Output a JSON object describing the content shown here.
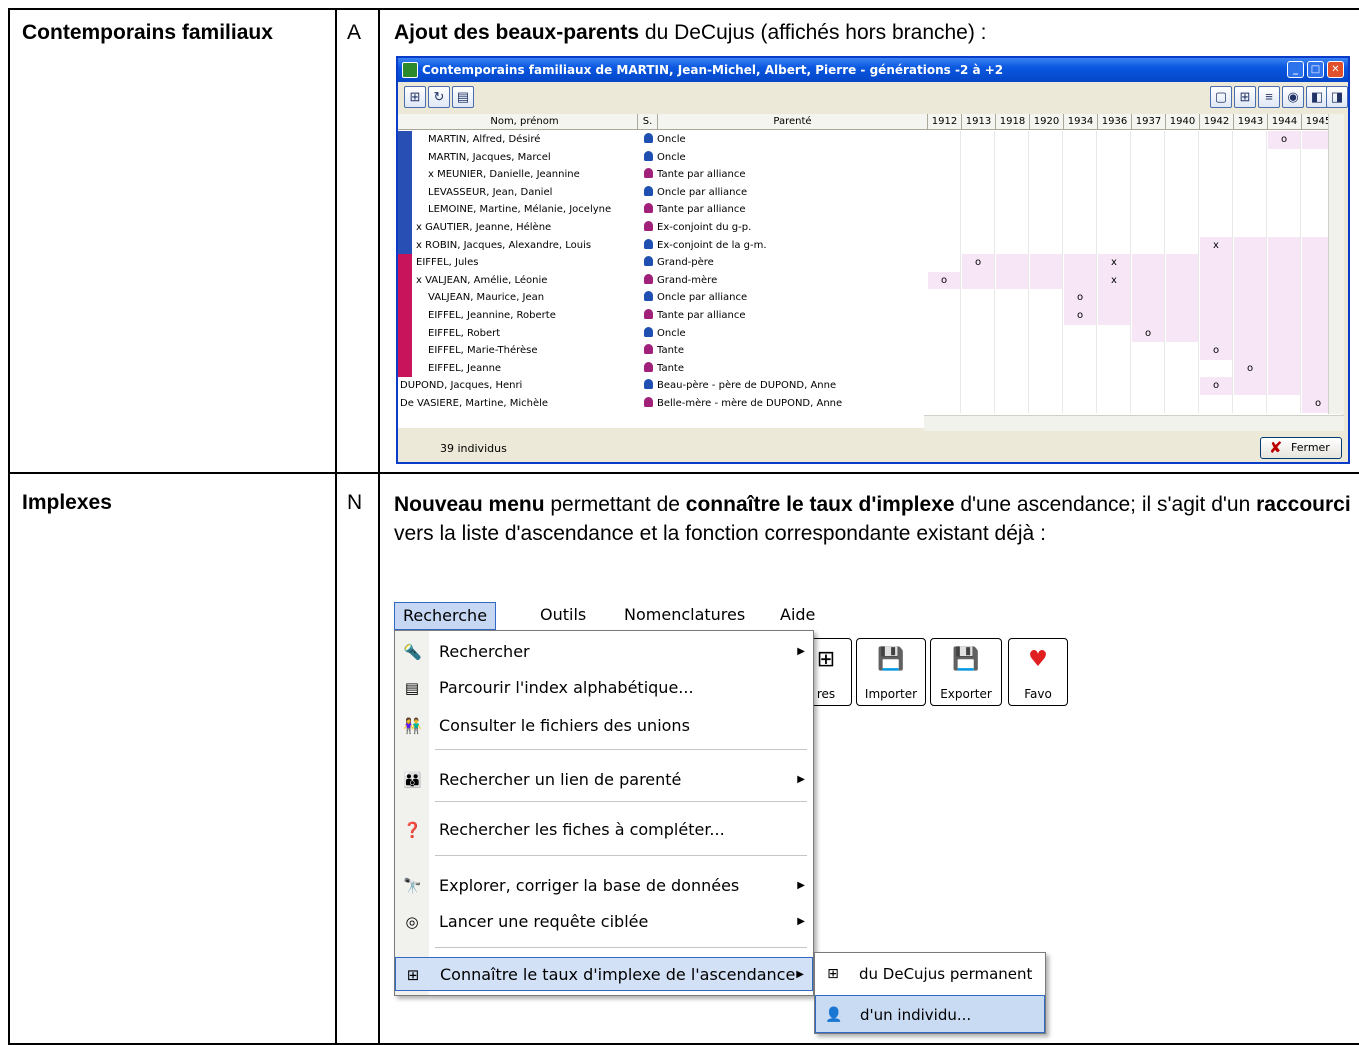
{
  "rows": [
    {
      "feature": "Contemporains familiaux",
      "code": "A",
      "desc_bold": "Ajout des beaux-parents",
      "desc_rest": " du DeCujus (affichés hors branche) :"
    },
    {
      "feature": "Implexes",
      "code": "N",
      "desc_parts": [
        {
          "t": "Nouveau menu",
          "b": true
        },
        {
          "t": " permettant de ",
          "b": false
        },
        {
          "t": "connaître le taux d'implexe",
          "b": true
        },
        {
          "t": " d'une ascendance; il s'agit d'un ",
          "b": false
        },
        {
          "t": "raccourci",
          "b": true
        },
        {
          "t": " vers la liste d'ascendance et la fonction correspondante existant déjà :",
          "b": false
        }
      ]
    }
  ],
  "window": {
    "title": "Contemporains familiaux de MARTIN, Jean-Michel, Albert, Pierre  -  générations -2 à +2",
    "columns": {
      "name": "Nom, prénom",
      "sex": "S.",
      "relation": "Parenté"
    },
    "years": [
      "1912",
      "1913",
      "1918",
      "1920",
      "1934",
      "1936",
      "1937",
      "1940",
      "1942",
      "1943",
      "1944",
      "1945"
    ],
    "people": [
      {
        "name": "MARTIN, Alfred, Désiré",
        "indent": true,
        "sex": "m",
        "relation": "Oncle",
        "group": "blue",
        "marks": {
          "1944": "o"
        }
      },
      {
        "name": "MARTIN, Jacques, Marcel",
        "indent": true,
        "sex": "m",
        "relation": "Oncle",
        "group": "blue",
        "marks": {}
      },
      {
        "name": "x MEUNIER, Danielle, Jeannine",
        "indent": true,
        "sex": "f",
        "relation": "Tante par alliance",
        "group": "blue",
        "marks": {}
      },
      {
        "name": "LEVASSEUR, Jean, Daniel",
        "indent": true,
        "sex": "m",
        "relation": "Oncle par alliance",
        "group": "blue",
        "marks": {}
      },
      {
        "name": "LEMOINE, Martine, Mélanie, Jocelyne",
        "indent": true,
        "sex": "f",
        "relation": "Tante par alliance",
        "group": "blue",
        "marks": {}
      },
      {
        "name": "x GAUTIER, Jeanne, Hélène",
        "indent": false,
        "sex": "f",
        "relation": "Ex-conjoint du g-p.",
        "group": "blue",
        "marks": {}
      },
      {
        "name": "x ROBIN, Jacques, Alexandre, Louis",
        "indent": false,
        "sex": "m",
        "relation": "Ex-conjoint de la g-m.",
        "group": "blue",
        "marks": {
          "1942": "x"
        }
      },
      {
        "name": "EIFFEL, Jules",
        "indent": false,
        "sex": "m",
        "relation": "Grand-père",
        "group": "pink",
        "marks": {
          "1913": "o",
          "1936": "x"
        }
      },
      {
        "name": "x VALJEAN, Amélie, Léonie",
        "indent": false,
        "sex": "f",
        "relation": "Grand-mère",
        "group": "pink",
        "marks": {
          "1912": "o",
          "1936": "x"
        }
      },
      {
        "name": "VALJEAN, Maurice, Jean",
        "indent": true,
        "sex": "m",
        "relation": "Oncle par alliance",
        "group": "pink",
        "marks": {
          "1934": "o"
        }
      },
      {
        "name": "EIFFEL, Jeannine, Roberte",
        "indent": true,
        "sex": "f",
        "relation": "Tante par alliance",
        "group": "pink",
        "marks": {
          "1934": "o"
        }
      },
      {
        "name": "EIFFEL, Robert",
        "indent": true,
        "sex": "m",
        "relation": "Oncle",
        "group": "pink",
        "marks": {
          "1937": "o"
        }
      },
      {
        "name": "EIFFEL, Marie-Thérèse",
        "indent": true,
        "sex": "f",
        "relation": "Tante",
        "group": "pink",
        "marks": {
          "1942": "o"
        }
      },
      {
        "name": "EIFFEL, Jeanne",
        "indent": true,
        "sex": "f",
        "relation": "Tante",
        "group": "pink",
        "marks": {
          "1943": "o"
        }
      },
      {
        "name": "DUPOND, Jacques, Henri",
        "indent": false,
        "sex": "m",
        "relation": "Beau-père - père de DUPOND, Anne",
        "group": "none",
        "marks": {
          "1942": "o"
        }
      },
      {
        "name": "De VASIERE, Martine, Michèle",
        "indent": false,
        "sex": "f",
        "relation": "Belle-mère - mère de DUPOND, Anne",
        "group": "none",
        "marks": {
          "1945": "o"
        }
      }
    ],
    "count": "39  individus",
    "close_label": "Fermer",
    "colors": {
      "blue": "#2850b4",
      "pink": "#c8145a",
      "male": "#1f4fb0",
      "female": "#a0207a",
      "shade": "#f6e6f6",
      "highlight": "#e8001c"
    }
  },
  "menu": {
    "bar": [
      "Recherche",
      "Outils",
      "Nomenclatures",
      "Aide"
    ],
    "items": [
      {
        "label": "Rechercher",
        "icon": "flashlight-icon",
        "glyph": "🔦",
        "arrow": true
      },
      {
        "label": "Parcourir l'index alphabétique...",
        "icon": "index-icon",
        "glyph": "▤",
        "arrow": false
      },
      {
        "label": "Consulter le fichiers des unions",
        "icon": "couple-icon",
        "glyph": "👫",
        "arrow": false
      },
      {
        "label": "Rechercher un lien de parenté",
        "icon": "family-icon",
        "glyph": "👪",
        "arrow": true
      },
      {
        "label": "Rechercher les fiches à compléter...",
        "icon": "cards-question-icon",
        "glyph": "❓",
        "arrow": false
      },
      {
        "label": "Explorer, corriger la base de données",
        "icon": "binoculars-icon",
        "glyph": "🔭",
        "arrow": true
      },
      {
        "label": "Lancer une requête ciblée",
        "icon": "target-icon",
        "glyph": "◎",
        "arrow": true
      },
      {
        "label": "Connaître le taux d'implexe de l'ascendance",
        "icon": "tree-icon",
        "glyph": "⊞",
        "arrow": true
      }
    ],
    "submenu": [
      {
        "label": "du DeCujus permanent",
        "icon": "tree-icon",
        "glyph": "⊞"
      },
      {
        "label": "d'un individu...",
        "icon": "person-icon",
        "glyph": "👤"
      }
    ],
    "tools": [
      {
        "label": "res",
        "icon": "tree-icon",
        "glyph": "⊞"
      },
      {
        "label": "Importer",
        "icon": "import-icon",
        "glyph": "💾"
      },
      {
        "label": "Exporter",
        "icon": "export-icon",
        "glyph": "💾"
      },
      {
        "label": "Favo",
        "icon": "hearts-icon",
        "glyph": "♥"
      }
    ]
  }
}
